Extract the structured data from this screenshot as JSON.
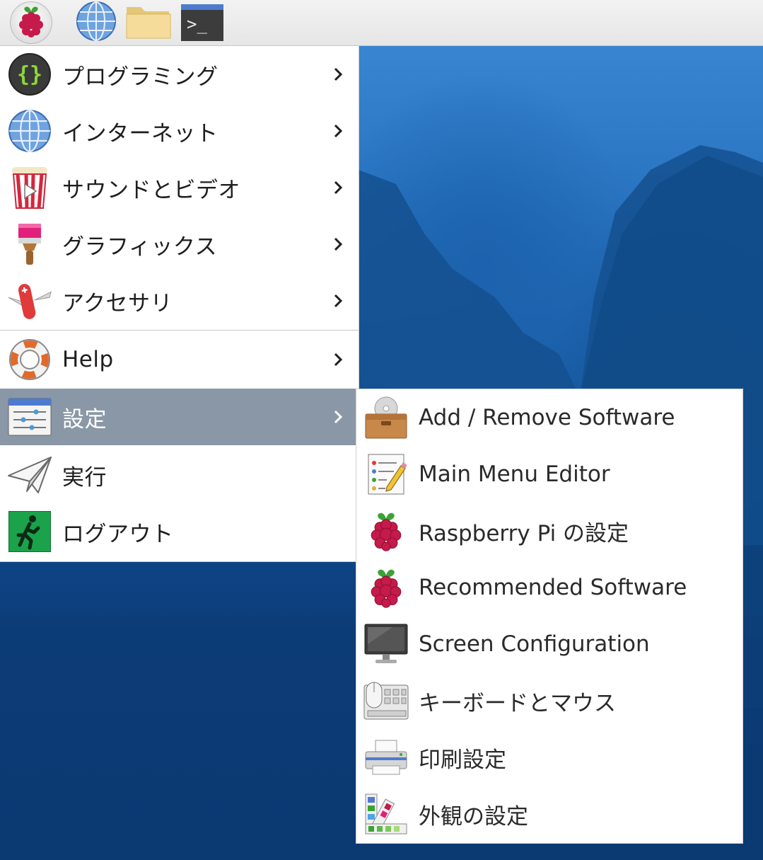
{
  "taskbar": {
    "buttons": [
      {
        "name": "raspberry-menu-button",
        "icon": "raspberry-icon"
      },
      {
        "name": "web-browser-button",
        "icon": "globe-icon"
      },
      {
        "name": "file-manager-button",
        "icon": "folder-icon"
      },
      {
        "name": "terminal-button",
        "icon": "terminal-icon",
        "glyph": ">_"
      }
    ]
  },
  "menu": {
    "items": [
      {
        "label": "プログラミング",
        "icon": "code-braces-icon",
        "has_submenu": true
      },
      {
        "label": "インターネット",
        "icon": "globe-icon",
        "has_submenu": true
      },
      {
        "label": "サウンドとビデオ",
        "icon": "popcorn-play-icon",
        "has_submenu": true
      },
      {
        "label": "グラフィックス",
        "icon": "paintbrush-icon",
        "has_submenu": true
      },
      {
        "label": "アクセサリ",
        "icon": "pocket-knife-icon",
        "has_submenu": true
      },
      {
        "label": "Help",
        "icon": "lifebuoy-icon",
        "has_submenu": true
      },
      {
        "label": "設定",
        "icon": "settings-sliders-icon",
        "has_submenu": true,
        "active": true
      },
      {
        "label": "実行",
        "icon": "paper-plane-icon",
        "has_submenu": false
      },
      {
        "label": "ログアウト",
        "icon": "exit-running-man-icon",
        "has_submenu": false
      }
    ]
  },
  "submenu": {
    "items": [
      {
        "label": "Add / Remove Software",
        "icon": "package-install-icon"
      },
      {
        "label": "Main Menu Editor",
        "icon": "menu-editor-icon"
      },
      {
        "label": "Raspberry Pi の設定",
        "icon": "raspberry-icon"
      },
      {
        "label": "Recommended Software",
        "icon": "raspberry-icon"
      },
      {
        "label": "Screen Configuration",
        "icon": "monitor-icon"
      },
      {
        "label": "キーボードとマウス",
        "icon": "keyboard-mouse-icon"
      },
      {
        "label": "印刷設定",
        "icon": "printer-icon"
      },
      {
        "label": "外観の設定",
        "icon": "color-palette-icon"
      }
    ]
  },
  "colors": {
    "active_item_bg": "#8a97a6",
    "menu_bg": "#ffffff",
    "desktop_blue": "#175aa3"
  }
}
